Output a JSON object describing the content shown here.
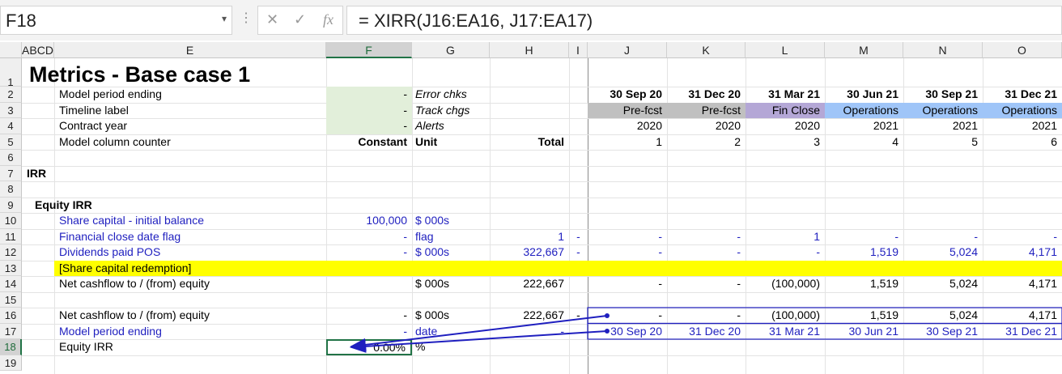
{
  "formula_bar": {
    "name_box": "F18",
    "cancel_icon": "✕",
    "enter_icon": "✓",
    "fx_icon": "fx",
    "formula": "= XIRR(J16:EA16, J17:EA17)"
  },
  "columns": [
    {
      "id": "ABCD",
      "label": "ABCD"
    },
    {
      "id": "E",
      "label": "E"
    },
    {
      "id": "F",
      "label": "F"
    },
    {
      "id": "G",
      "label": "G"
    },
    {
      "id": "H",
      "label": "H"
    },
    {
      "id": "I",
      "label": "I"
    },
    {
      "id": "J",
      "label": "J"
    },
    {
      "id": "K",
      "label": "K"
    },
    {
      "id": "L",
      "label": "L"
    },
    {
      "id": "M",
      "label": "M"
    },
    {
      "id": "N",
      "label": "N"
    },
    {
      "id": "O",
      "label": "O"
    }
  ],
  "rows": [
    "1",
    "2",
    "3",
    "4",
    "5",
    "6",
    "7",
    "8",
    "9",
    "10",
    "11",
    "12",
    "13",
    "14",
    "15",
    "16",
    "17",
    "18",
    "19"
  ],
  "sheet": {
    "title": "Metrics - Base case 1",
    "r2": {
      "label": "Model period ending",
      "f": "-",
      "g": "Error chks",
      "periods": [
        "30 Sep 20",
        "31 Dec 20",
        "31 Mar 21",
        "30 Jun 21",
        "30 Sep 21",
        "31 Dec 21"
      ]
    },
    "r3": {
      "label": "Timeline label",
      "f": "-",
      "g": "Track chgs",
      "stages": [
        "Pre-fcst",
        "Pre-fcst",
        "Fin Close",
        "Operations",
        "Operations",
        "Operations"
      ]
    },
    "r4": {
      "label": "Contract year",
      "f": "-",
      "g": "Alerts",
      "years": [
        "2020",
        "2020",
        "2020",
        "2021",
        "2021",
        "2021"
      ]
    },
    "r5": {
      "label": "Model column counter",
      "f": "Constant",
      "g": "Unit",
      "h": "Total",
      "counters": [
        "1",
        "2",
        "3",
        "4",
        "5",
        "6"
      ]
    },
    "r7": {
      "label": "IRR"
    },
    "r9": {
      "label": "Equity IRR"
    },
    "r10": {
      "label": "Share capital - initial balance",
      "f": "100,000",
      "g": "$ 000s"
    },
    "r11": {
      "label": "Financial close date flag",
      "f": "-",
      "g": "flag",
      "h": "1",
      "i": "-",
      "values": [
        "-",
        "-",
        "1",
        "-",
        "-",
        "-"
      ]
    },
    "r12": {
      "label": "Dividends paid POS",
      "f": "-",
      "g": "$ 000s",
      "h": "322,667",
      "i": "-",
      "values": [
        "-",
        "-",
        "-",
        "1,519",
        "5,024",
        "4,171"
      ]
    },
    "r13": {
      "label": "[Share capital redemption]"
    },
    "r14": {
      "label": "Net cashflow to / (from) equity",
      "g": "$ 000s",
      "h": "222,667",
      "values": [
        "-",
        "-",
        "(100,000)",
        "1,519",
        "5,024",
        "4,171"
      ]
    },
    "r16": {
      "label": "Net cashflow to / (from) equity",
      "f": "-",
      "g": "$ 000s",
      "h": "222,667",
      "i": "-",
      "values": [
        "-",
        "-",
        "(100,000)",
        "1,519",
        "5,024",
        "4,171"
      ]
    },
    "r17": {
      "label": "Model period ending",
      "f": "-",
      "g": "date",
      "h": "-",
      "values": [
        "30 Sep 20",
        "31 Dec 20",
        "31 Mar 21",
        "30 Jun 21",
        "30 Sep 21",
        "31 Dec 21"
      ]
    },
    "r18": {
      "label": "Equity IRR",
      "f": "0.00%",
      "g": "%"
    }
  },
  "colors": {
    "input_green": "#e2efda",
    "prefcst_gray": "#c0c0c0",
    "finclose_purple": "#b4a7d6",
    "operations_blue": "#9fc5f8",
    "highlight_yellow": "#ffff00",
    "trace_arrow": "#1f1fbf",
    "selection_green": "#217346"
  }
}
